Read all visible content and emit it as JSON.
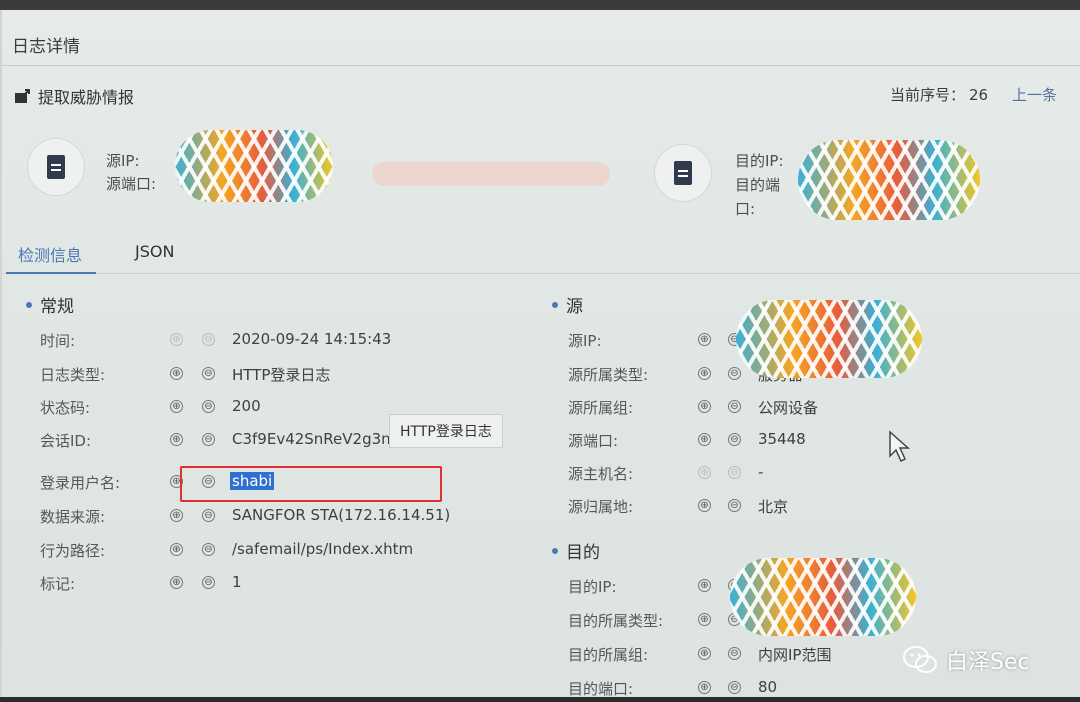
{
  "dialog": {
    "title": "日志详情"
  },
  "toolbar": {
    "extract_label": "提取威胁情报",
    "seq_label": "当前序号：",
    "seq_value": "26",
    "prev_label": "上一条"
  },
  "header": {
    "src_ip_label": "源IP:",
    "src_port_label": "源端口:",
    "dst_ip_label": "目的IP:",
    "dst_port_label": "目的端",
    "dst_port_label2": "口:"
  },
  "tabs": [
    {
      "label": "检测信息"
    },
    {
      "label": "JSON"
    }
  ],
  "general": {
    "heading": "常规",
    "rows": [
      {
        "key": "时间:",
        "value": "2020-09-24 14:15:43"
      },
      {
        "key": "日志类型:",
        "value": "HTTP登录日志"
      },
      {
        "key": "状态码:",
        "value": "200"
      },
      {
        "key": "会话ID:",
        "value": "C3f9Ev42SnReV2g3nIzMeHH"
      },
      {
        "key": "登录用户名:",
        "value": "shabi"
      },
      {
        "key": "数据来源:",
        "value": "SANGFOR STA(172.16.14.51)"
      },
      {
        "key": "行为路径:",
        "value": "/safemail/ps/Index.xhtm"
      },
      {
        "key": "标记:",
        "value": "1"
      }
    ]
  },
  "source": {
    "heading": "源",
    "rows": [
      {
        "key": "源IP:",
        "value": ""
      },
      {
        "key": "源所属类型:",
        "value": "服务器"
      },
      {
        "key": "源所属组:",
        "value": "公网设备"
      },
      {
        "key": "源端口:",
        "value": "35448"
      },
      {
        "key": "源主机名:",
        "value": "-"
      },
      {
        "key": "源归属地:",
        "value": "北京"
      }
    ]
  },
  "dest": {
    "heading": "目的",
    "rows": [
      {
        "key": "目的IP:",
        "value": ""
      },
      {
        "key": "目的所属类型:",
        "value": ""
      },
      {
        "key": "目的所属组:",
        "value": "内网IP范围"
      },
      {
        "key": "目的端口:",
        "value": "80"
      }
    ]
  },
  "tooltip": {
    "text": "HTTP登录日志"
  },
  "watermark": {
    "text": "白泽Sec"
  },
  "icons": {
    "add": "⊕",
    "remove": "⊖"
  }
}
